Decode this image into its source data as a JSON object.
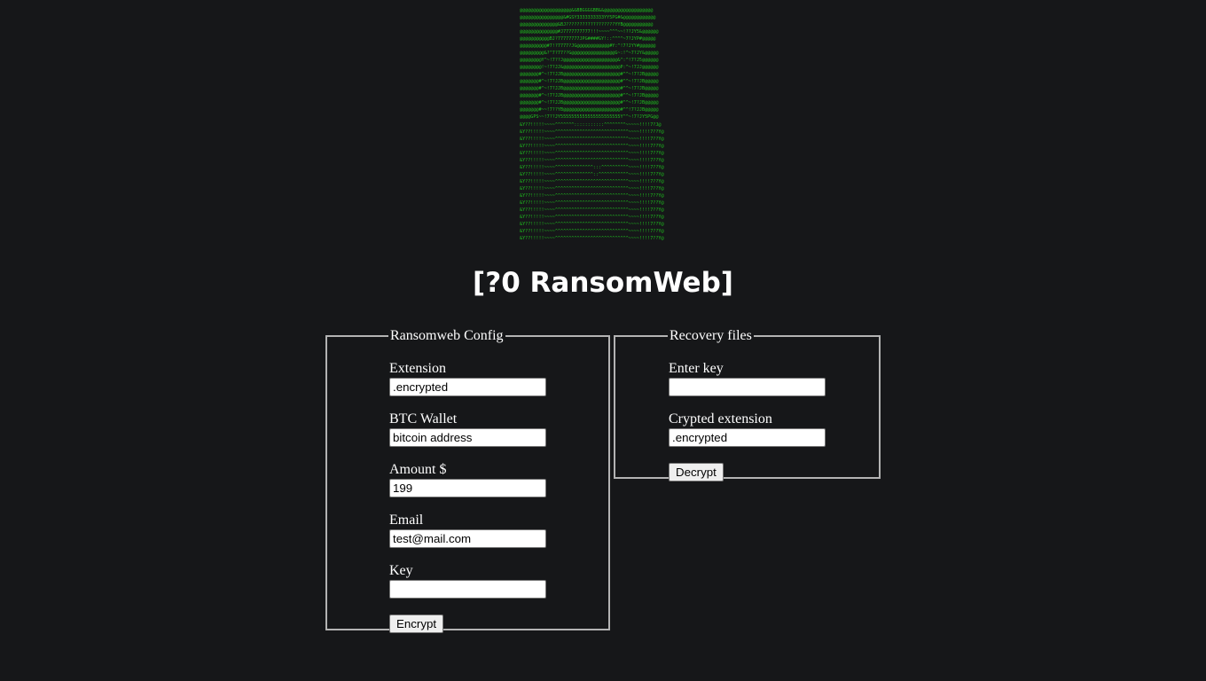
{
  "banner": {
    "ascii_art": "@@@@@@@@@@@@@@@@@@@&&BBGGGGBB&&@@@@@@@@@@@@@@@@@@\n@@@@@@@@@@@@@@@@&#GSY3333333333YY5PG#&@@@@@@@@@@@@\n@@@@@@@@@@@@@@&BJ??????????????????YYB@@@@@@@@@@@\n@@@@@@@@@@@@@@#J7777777777!!!~~~~^^^~~!??JY5&@@@@@@\n@@@@@@@@@@@BJ?77777777JPG####GY!::^^^^~7?JYP#@@@@@\n@@@@@@@@@@#7!?7777?JG@@@@@@@@@@@@#Y:^!7?JYY#@@@@@@\n@@@@@@@@@&?^7?77??G@@@@@@@@@@@@@@@@G~:!^~7?JY&@@@@@\n@@@@@@@@Y^~!7??J@@@@@@@@@@@@@@@@@@@@&^:^!7?J5@@@@@@\n@@@@@@@@!~!7?JJ&@@@@@@@@@@@@@@@@@@@@@P:^~!7JJ@@@@@@\n@@@@@@@#^~!7?JJB@@@@@@@@@@@@@@@@@@@@@#^^~!7?JB@@@@@\n@@@@@@@#^~!7?JJB@@@@@@@@@@@@@@@@@@@@@#^^~!7?JB@@@@@\n@@@@@@@#^~!7?JJB@@@@@@@@@@@@@@@@@@@@@#^^~!7?JB@@@@@\n@@@@@@@#^~!7?JJB@@@@@@@@@@@@@@@@@@@@@#^^~!7?JB@@@@@\n@@@@@@@#^~!7?JJB@@@@@@@@@@@@@@@@@@@@@#^^~!7?JB@@@@@\n@@@@@@@#~~!7??YB@@@@@@@@@@@@@@@@@@@@@#^^!7?JJB@@@@@\n@@@@GPS~~!7??JY5555555555555555555555Y^^~!7?JY5PG@@\n&Y??!!!!!~~~~^^^^^^^:::::::::::^^^^^^^^~~~~~!!!!7?J@\n&Y??!!!!!~~~~^^^^^^^^^^^^^^^^^^^^^^^^^^^~~~~!!!!7??Y@\n&Y??!!!!!~~~~^^^^^^^^^^^^^^^^^^^^^^^^^^^~~~~!!!!7??Y@\n&Y??!!!!!~~~~^^^^^^^^^^^^^^^^^^^^^^^^^^^~~~~!!!!7??Y@\n&Y??!!!!!~~~~^^^^^^^^^^^^^^^^^^^^^^^^^^^~~~~!!!!7??Y@\n&Y??!!!!!~~~~^^^^^^^^^^^^^^^^^^^^^^^^^^^~~~~!!!!7??Y@\n&Y??!!!!!~~~~^^^^^^^^^^^^^^:::^^^^^^^^^^~~~~!!!!7??Y@\n&Y??!!!!!~~~~^^^^^^^^^^^^^^::^^^^^^^^^^^~~~~!!!!7??Y@\n&Y??!!!!!~~~~^^^^^^^^^^^^^^^^^^^^^^^^^^^~~~~!!!!7??Y@\n&Y??!!!!!~~~~^^^^^^^^^^^^^^^^^^^^^^^^^^^~~~~!!!!7??Y@\n&Y??!!!!!~~~~^^^^^^^^^^^^^^^^^^^^^^^^^^^~~~~!!!!7??Y@\n&Y??!!!!!~~~~^^^^^^^^^^^^^^^^^^^^^^^^^^^~~~~!!!!7??Y@\n&Y??!!!!!~~~~^^^^^^^^^^^^^^^^^^^^^^^^^^^~~~~!!!!7??Y@\n&Y??!!!!!~~~~^^^^^^^^^^^^^^^^^^^^^^^^^^^~~~~!!!!7??Y@\n&Y??!!!!!~~~~^^^^^^^^^^^^^^^^^^^^^^^^^^^~~~~!!!!7??Y@\n&Y??!!!!!~~~~^^^^^^^^^^^^^^^^^^^^^^^^^^^~~~~!!!!7??Y@\n&Y??!!!!!~~~~^^^^^^^^^^^^^^^^^^^^^^^^^^^~~~~!!!!7??Y@\n&Y??!!!!!~~~~^^^^^^^^^^^^^^^^^^^^^^^^^^^~~~~!!!!7??Y@\n&Y??!!!!~~~~^^^^^^^^^::::::::::::^^^^^^^^~~~~!!!!7??Y@\n@BGGPPPPPPPPP5555555555555555555555555PPPPPPPPPPGGB@"
  },
  "title": "[?0 RansomWeb]",
  "config": {
    "legend": "Ransomweb Config",
    "extension_label": "Extension",
    "extension_value": ".encrypted",
    "wallet_label": "BTC Wallet",
    "wallet_value": "bitcoin address",
    "amount_label": "Amount $",
    "amount_value": "199",
    "email_label": "Email",
    "email_value": "test@mail.com",
    "key_label": "Key",
    "key_value": "",
    "encrypt_label": "Encrypt"
  },
  "recovery": {
    "legend": "Recovery files",
    "enter_key_label": "Enter key",
    "enter_key_value": "",
    "crypted_ext_label": "Crypted extension",
    "crypted_ext_value": ".encrypted",
    "decrypt_label": "Decrypt"
  },
  "colors": {
    "background": "#161719",
    "ascii_green": "#1fbf1f",
    "border": "#b3b3b3"
  }
}
